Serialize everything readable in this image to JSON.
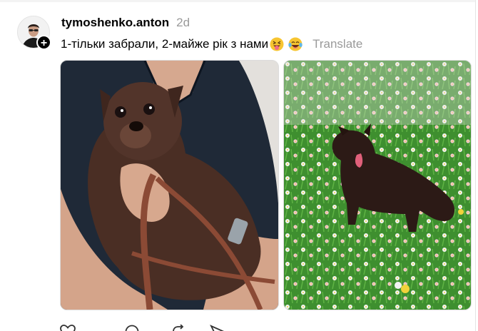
{
  "post": {
    "username": "tymoshenko.anton",
    "timestamp": "2d",
    "caption": "1-тільки забрали, 2-майже рік з нами",
    "caption_emojis": [
      "squinting-face-with-tongue",
      "face-with-tears-of-joy"
    ],
    "translate_label": "Translate",
    "follow_badge": "+"
  },
  "media": [
    {
      "name": "photo-puppy-held-in-arms"
    },
    {
      "name": "photo-dog-in-flower-field"
    }
  ],
  "actions": [
    {
      "icon": "heart-icon"
    },
    {
      "icon": "comment-icon"
    },
    {
      "icon": "repost-icon"
    },
    {
      "icon": "share-icon"
    }
  ],
  "colors": {
    "text": "#000000",
    "muted": "#9a9a9a",
    "divider": "#e5e5e5"
  }
}
